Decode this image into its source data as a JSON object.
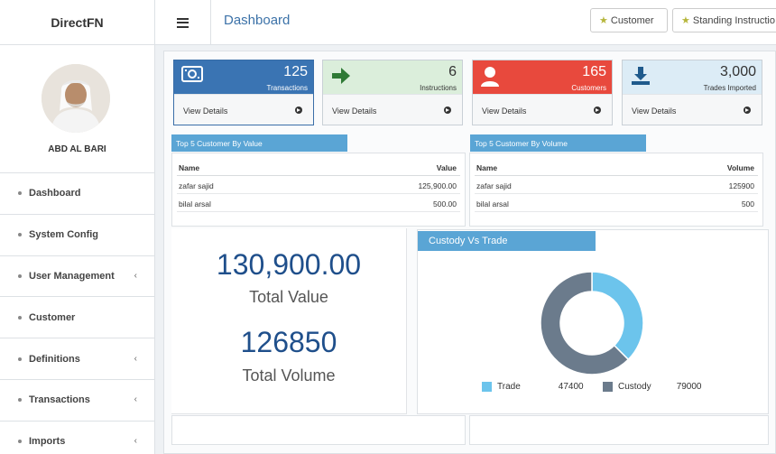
{
  "brand": "DirectFN",
  "header": {
    "page_title": "Dashboard",
    "buttons": [
      {
        "label": "Customer"
      },
      {
        "label": "Standing Instructio"
      }
    ]
  },
  "user": {
    "name": "ABD AL BARI"
  },
  "sidebar": {
    "items": [
      {
        "label": "Dashboard",
        "has_children": false
      },
      {
        "label": "System Config",
        "has_children": false
      },
      {
        "label": "User Management",
        "has_children": true
      },
      {
        "label": "Customer",
        "has_children": false
      },
      {
        "label": "Definitions",
        "has_children": true
      },
      {
        "label": "Transactions",
        "has_children": true
      },
      {
        "label": "Imports",
        "has_children": true
      }
    ]
  },
  "stats": [
    {
      "value": "125",
      "label": "Transactions",
      "link": "View Details",
      "icon": "money-icon",
      "color": "#3a74b3"
    },
    {
      "value": "6",
      "label": "Instructions",
      "link": "View Details",
      "icon": "arrow-right-icon",
      "color": "#dbeedb"
    },
    {
      "value": "165",
      "label": "Customers",
      "link": "View Details",
      "icon": "user-icon",
      "color": "#e8493d"
    },
    {
      "value": "3,000",
      "label": "Trades Imported",
      "link": "View Details",
      "icon": "download-icon",
      "color": "#dcecf6"
    }
  ],
  "top_by_value": {
    "title": "Top 5 Customer By Value",
    "columns": [
      "Name",
      "Value"
    ],
    "rows": [
      [
        "zafar sajid",
        "125,900.00"
      ],
      [
        "bilal arsal",
        "500.00"
      ]
    ]
  },
  "top_by_volume": {
    "title": "Top 5 Customer By Volume",
    "columns": [
      "Name",
      "Volume"
    ],
    "rows": [
      [
        "zafar sajid",
        "125900"
      ],
      [
        "bilal arsal",
        "500"
      ]
    ]
  },
  "totals": {
    "value": "130,900.00",
    "value_label": "Total Value",
    "volume": "126850",
    "volume_label": "Total Volume"
  },
  "custody_chart": {
    "title": "Custody Vs Trade",
    "legend": [
      {
        "label": "Trade",
        "value": "47400"
      },
      {
        "label": "Custody",
        "value": "79000"
      }
    ]
  },
  "chart_data": {
    "type": "pie",
    "title": "Custody Vs Trade",
    "categories": [
      "Trade",
      "Custody"
    ],
    "values": [
      47400,
      79000
    ],
    "colors": [
      "#6cc4ec",
      "#6b7b8c"
    ],
    "donut": true,
    "legend": "bottom"
  },
  "colors": {
    "accent": "#3c72a8",
    "section_tab": "#5aa5d5",
    "big_number": "#1f4f8b"
  }
}
